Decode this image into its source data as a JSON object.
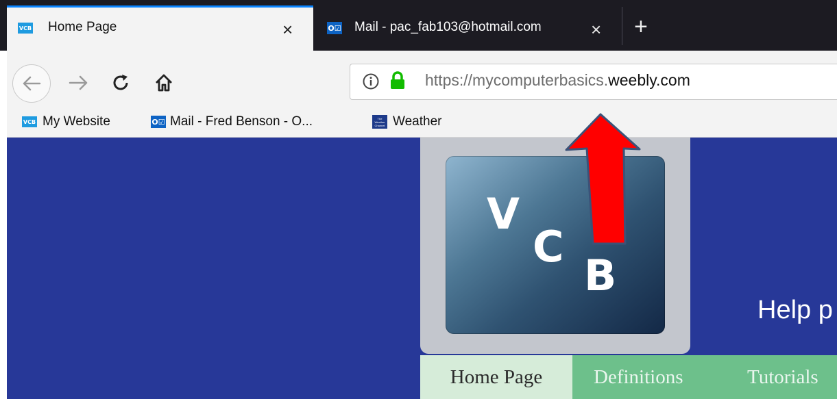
{
  "tabs": [
    {
      "favicon": "VCB",
      "title": "Home Page",
      "active": true
    },
    {
      "favicon": "O☑",
      "title": "Mail - pac_fab103@hotmail.com",
      "active": false
    }
  ],
  "toolbar": {
    "url_prefix": "https://mycomputerbasics.",
    "url_domain": "weebly.com"
  },
  "bookmarks": [
    {
      "favicon": "VCB",
      "label": "My Website"
    },
    {
      "favicon": "O☑",
      "label": "Mail - Fred Benson - O..."
    },
    {
      "favicon": "The Weather Channel",
      "label": "Weather"
    }
  ],
  "page": {
    "logo": {
      "letters": [
        "V",
        "C",
        "B"
      ]
    },
    "tagline": "Help p",
    "nav": [
      "Home Page",
      "Definitions",
      "Tutorials"
    ]
  },
  "annotation": {
    "color": "#ff0000"
  }
}
